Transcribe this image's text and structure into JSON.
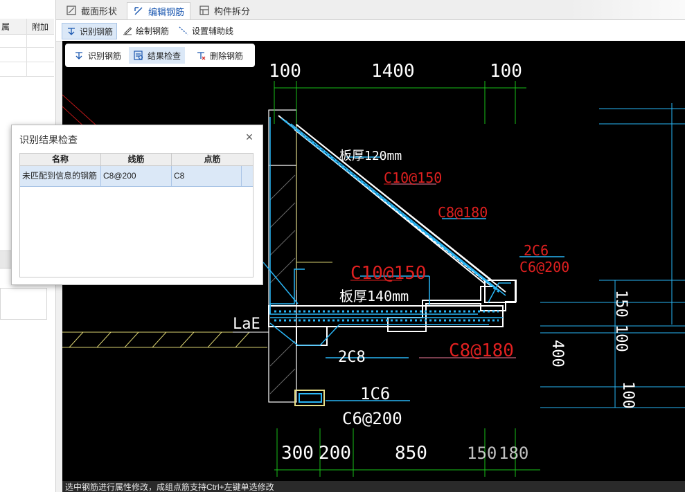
{
  "left_panel": {
    "col_label": "属",
    "col_extra": "附加"
  },
  "tabs": [
    {
      "label": "截面形状",
      "icon": "section-shape-icon"
    },
    {
      "label": "编辑钢筋",
      "icon": "edit-rebar-icon"
    },
    {
      "label": "构件拆分",
      "icon": "component-split-icon"
    }
  ],
  "toolbar": {
    "items": [
      {
        "label": "识别钢筋",
        "icon": "identify-rebar-icon"
      },
      {
        "label": "绘制钢筋",
        "icon": "draw-rebar-icon"
      },
      {
        "label": "设置辅助线",
        "icon": "guide-line-icon"
      }
    ]
  },
  "subbar": {
    "items": [
      {
        "label": "识别钢筋",
        "icon": "identify-rebar-icon"
      },
      {
        "label": "结果检查",
        "icon": "result-check-icon"
      },
      {
        "label": "删除钢筋",
        "icon": "delete-rebar-icon"
      }
    ]
  },
  "dialog": {
    "title": "识别结果检查",
    "columns": [
      "名称",
      "线筋",
      "点筋"
    ],
    "rows": [
      {
        "name": "未匹配到信息的钢筋",
        "line_rebar": "C8@200",
        "point_rebar": "C8"
      }
    ]
  },
  "drawing": {
    "dims_top": [
      "100",
      "1400",
      "100"
    ],
    "dims_bottom": [
      "300",
      "200",
      "850",
      "150",
      "180"
    ],
    "dims_right": [
      "150",
      "100",
      "400",
      "100"
    ],
    "labels": {
      "thick120": "板厚120mm",
      "c10_150_top": "C10@150",
      "c8_180_top": "C8@180",
      "two_c6": "2C6",
      "c6_200_right": "C6@200",
      "c10_150_mid": "C10@150",
      "thick140": "板厚140mm",
      "lae": "LaE",
      "c8_180_bot": "C8@180",
      "two_c8": "2C8",
      "one_c6": "1C6",
      "c6_200_bot": "C6@200"
    },
    "colors": {
      "bg": "#000000",
      "dim": "#19c019",
      "rebar": "#29b6f6",
      "outline": "#ffffff",
      "red": "#e02020",
      "yellow": "#e8e08a"
    }
  },
  "statusbar": {
    "text": "选中钢筋进行属性修改，成组点筋支持Ctrl+左键单选修改"
  }
}
